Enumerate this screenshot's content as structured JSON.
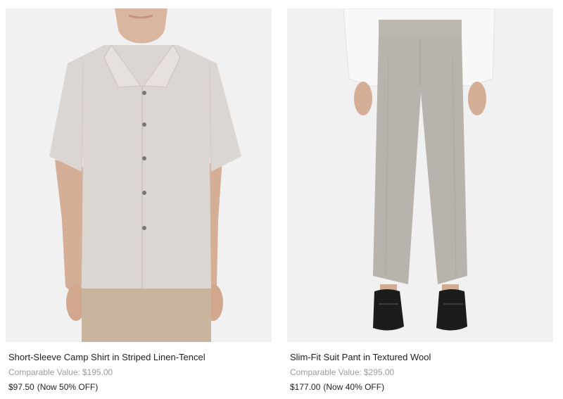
{
  "products": [
    {
      "image_alt": "Short-Sleeve Camp Shirt in Striped Linen-Tencel",
      "title": "Short-Sleeve Camp Shirt in Striped Linen-Tencel",
      "comparable_label": "Comparable Value:",
      "comparable_value": "$195.00",
      "price": "$97.50",
      "discount": "(Now 50% OFF)"
    },
    {
      "image_alt": "Slim-Fit Suit Pant in Textured Wool",
      "title": "Slim-Fit Suit Pant in Textured Wool",
      "comparable_label": "Comparable Value:",
      "comparable_value": "$295.00",
      "price": "$177.00",
      "discount": "(Now 40% OFF)"
    }
  ],
  "colors": {
    "image_bg": "#f1f1f2",
    "shirt": "#dcd6d2",
    "pants_beige": "#c9b59e",
    "pant_gray": "#b8b3ac",
    "shoe": "#1c1c1c",
    "muted_text": "#9b9b9b"
  }
}
